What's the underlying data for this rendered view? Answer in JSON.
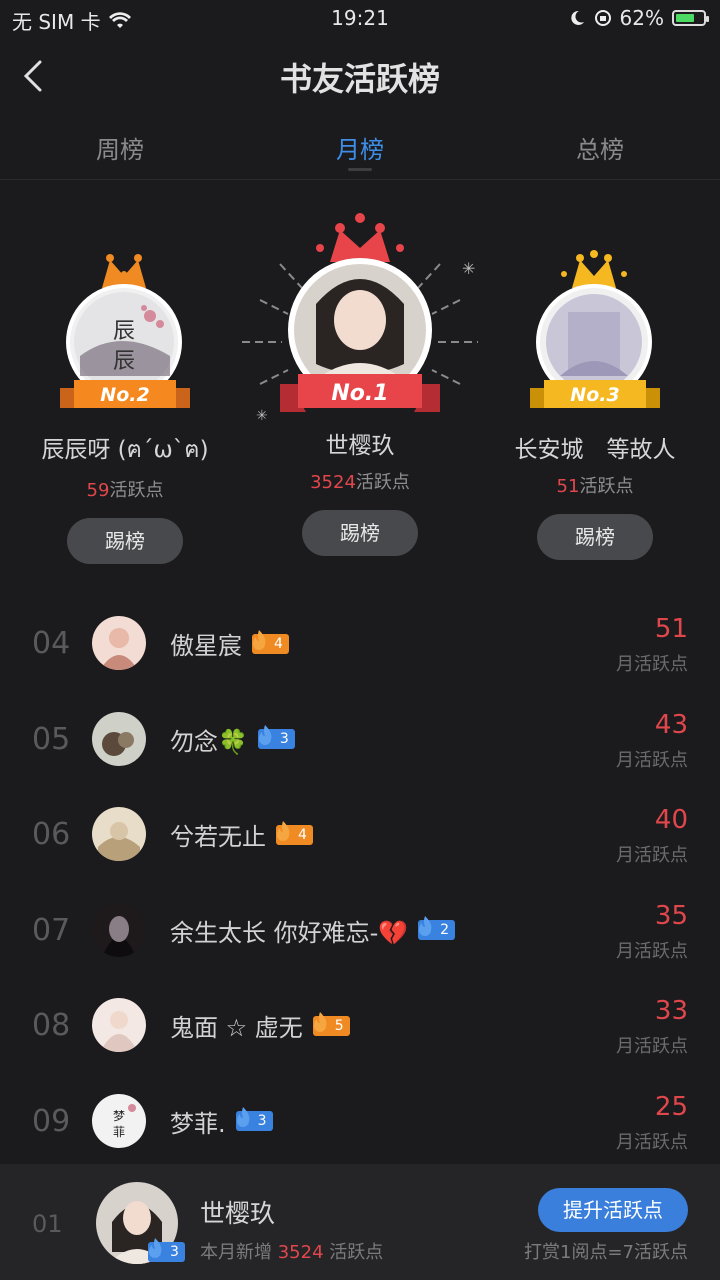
{
  "status": {
    "carrier": "无 SIM 卡",
    "time": "19:21",
    "battery": "62%"
  },
  "header": {
    "title": "书友活跃榜"
  },
  "tabs": [
    {
      "label": "周榜"
    },
    {
      "label": "月榜"
    },
    {
      "label": "总榜"
    }
  ],
  "active_tab": 1,
  "podium": [
    {
      "badge": "No.2",
      "name": "辰辰呀 (ฅ´ω`ฅ)",
      "points": "59",
      "points_unit": "活跃点",
      "kick": "踢榜",
      "avatar_text": "辰辰"
    },
    {
      "badge": "No.1",
      "name": "世樱玖",
      "points": "3524",
      "points_unit": "活跃点",
      "kick": "踢榜"
    },
    {
      "badge": "No.3",
      "name": "长安城　等故人",
      "points": "51",
      "points_unit": "活跃点",
      "kick": "踢榜"
    }
  ],
  "list": [
    {
      "rank": "04",
      "name": "傲星宸",
      "level": "4",
      "level_color": "orange",
      "value": "51",
      "sub": "月活跃点"
    },
    {
      "rank": "05",
      "name": "勿念🍀",
      "level": "3",
      "level_color": "blue",
      "value": "43",
      "sub": "月活跃点"
    },
    {
      "rank": "06",
      "name": "兮若无止",
      "level": "4",
      "level_color": "orange",
      "value": "40",
      "sub": "月活跃点"
    },
    {
      "rank": "07",
      "name": "余生太长 你好难忘-💔",
      "level": "2",
      "level_color": "blue",
      "value": "35",
      "sub": "月活跃点"
    },
    {
      "rank": "08",
      "name": "鬼面 ☆ 虚无",
      "level": "5",
      "level_color": "orange",
      "value": "33",
      "sub": "月活跃点"
    },
    {
      "rank": "09",
      "name": "梦菲.",
      "level": "3",
      "level_color": "blue",
      "value": "25",
      "sub": "月活跃点",
      "avatar_text": "梦菲"
    }
  ],
  "me": {
    "rank": "01",
    "name": "世樱玖",
    "level": "3",
    "sub_prefix": "本月新增",
    "sub_points": "3524",
    "sub_suffix": "活跃点",
    "button": "提升活跃点",
    "note": "打赏1阅点=7活跃点"
  },
  "colors": {
    "accent_blue": "#3e8ee8",
    "points_red": "#e0474c",
    "gold": "#f5b820",
    "orange": "#f08a23",
    "red_ribbon": "#e8454a"
  }
}
